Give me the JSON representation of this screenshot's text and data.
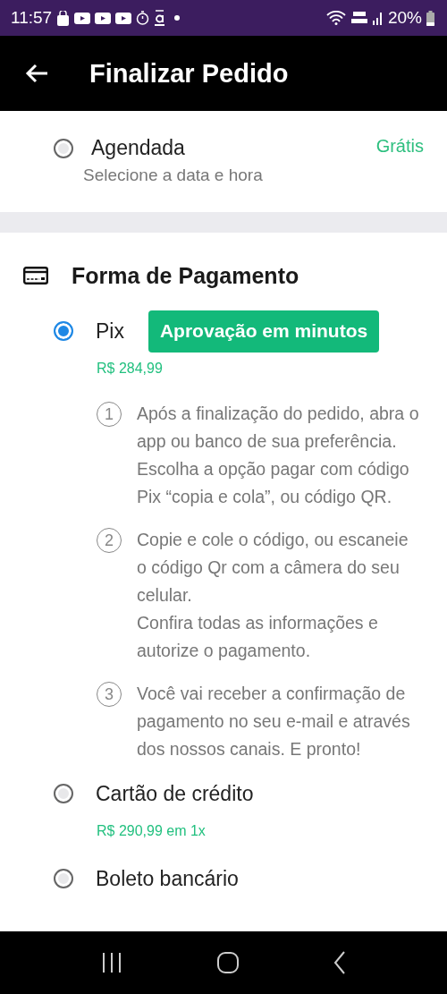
{
  "status_bar": {
    "time": "11:57",
    "battery": "20%"
  },
  "header": {
    "title": "Finalizar Pedido"
  },
  "delivery_option": {
    "label": "Agendada",
    "subtitle": "Selecione a data e hora",
    "price": "Grátis",
    "selected": false
  },
  "payment": {
    "title": "Forma de Pagamento",
    "methods": [
      {
        "label": "Pix",
        "selected": true,
        "badge": "Aprovação em minutos",
        "price": "R$ 284,99",
        "steps": [
          {
            "number": "1",
            "paragraphs": [
              "Após a finalização do pedido, abra o app ou banco de sua preferência. Escolha a opção pagar com código Pix “copia e cola”, ou código QR."
            ]
          },
          {
            "number": "2",
            "paragraphs": [
              "Copie e cole o código, ou escaneie o código Qr com a câmera do seu celular.",
              "Confira todas as informações e autorize o pagamento."
            ]
          },
          {
            "number": "3",
            "paragraphs": [
              "Você vai receber a confirmação de pagamento no seu e-mail e através dos nossos canais. E pronto!"
            ]
          }
        ]
      },
      {
        "label": "Cartão de crédito",
        "selected": false,
        "price": "R$ 290,99 em 1x"
      },
      {
        "label": "Boleto bancário",
        "selected": false
      }
    ]
  }
}
